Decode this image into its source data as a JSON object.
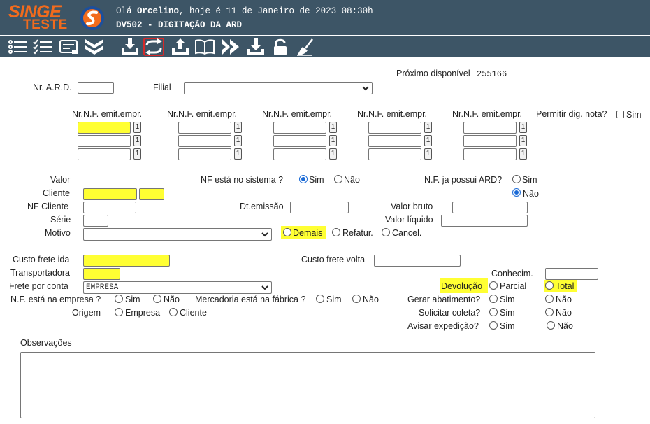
{
  "header": {
    "logo": "SINGE",
    "logo_sub": "TESTE",
    "greeting_prefix": "Olá ",
    "user": "Orcelino",
    "greeting_suffix": ", hoje é 11 de Janeiro de 2023 08:30h",
    "title": "DV502 - DIGITAÇÃO DA ARD"
  },
  "toolbar": [
    "list-icon",
    "checklist-icon",
    "keyboard-icon",
    "double-chevron-down-icon",
    "tray-download-icon",
    "refresh-icon",
    "tray-upload-icon",
    "book-icon",
    "double-chevron-right-icon",
    "download-icon",
    "unlock-icon",
    "broom-icon"
  ],
  "form": {
    "proximo_label": "Próximo disponível",
    "proximo_value": "255166",
    "nr_ard_label": "Nr. A.R.D.",
    "filial_label": "Filial",
    "nf_col_label": "Nr.N.F. emit.empr.",
    "permitir_label": "Permitir dig. nota?",
    "sim": "Sim",
    "nao": "Não",
    "mini": "1",
    "valor_label": "Valor",
    "nf_sistema_label": "NF está no sistema ?",
    "nf_ard_label": "N.F. ja possui ARD?",
    "cliente_label": "Cliente",
    "nf_cliente_label": "NF Cliente",
    "dt_emissao_label": "Dt.emissão",
    "valor_bruto_label": "Valor bruto",
    "serie_label": "Série",
    "valor_liquido_label": "Valor líquido",
    "motivo_label": "Motivo",
    "demais": "Demais",
    "refatur": "Refatur.",
    "cancel": "Cancel.",
    "custo_ida_label": "Custo frete ida",
    "custo_volta_label": "Custo frete volta",
    "transportadora_label": "Transportadora",
    "conhecim_label": "Conhecim.",
    "frete_conta_label": "Frete por conta",
    "frete_conta_value": "EMPRESA",
    "devolucao_label": "Devolução",
    "parcial": "Parcial",
    "total": "Total",
    "nf_empresa_label": "N.F. está na empresa ?",
    "mercadoria_label": "Mercadoria está na fábrica ?",
    "gerar_label": "Gerar abatimento?",
    "origem_label": "Origem",
    "empresa": "Empresa",
    "cliente": "Cliente",
    "solicitar_label": "Solicitar coleta?",
    "avisar_label": "Avisar expedição?",
    "observacoes_label": "Observações"
  },
  "colors": {
    "header": "#3d5566",
    "accent": "#f26b1d",
    "highlight": "#ffff33",
    "radio_on": "#1a6ad6"
  }
}
